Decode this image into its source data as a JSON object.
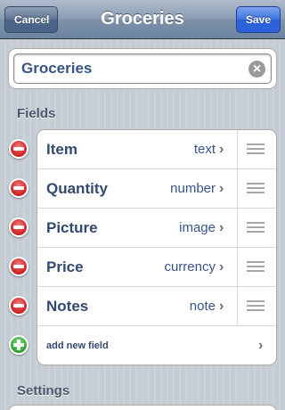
{
  "navbar": {
    "title": "Groceries",
    "cancel_label": "Cancel",
    "save_label": "Save"
  },
  "name_field": {
    "value": "Groceries",
    "clear_icon": "clear-icon"
  },
  "sections": {
    "fields_header": "Fields",
    "settings_header": "Settings"
  },
  "fields": [
    {
      "label": "Item",
      "type": "text"
    },
    {
      "label": "Quantity",
      "type": "number"
    },
    {
      "label": "Picture",
      "type": "image"
    },
    {
      "label": "Price",
      "type": "currency"
    },
    {
      "label": "Notes",
      "type": "note"
    }
  ],
  "add_field_label": "add new field",
  "colors": {
    "navbar": "#6d84a2",
    "save_button": "#2d63da",
    "delete_icon": "#d42a2a",
    "add_icon": "#3aa83a",
    "label_text": "#33496f"
  }
}
